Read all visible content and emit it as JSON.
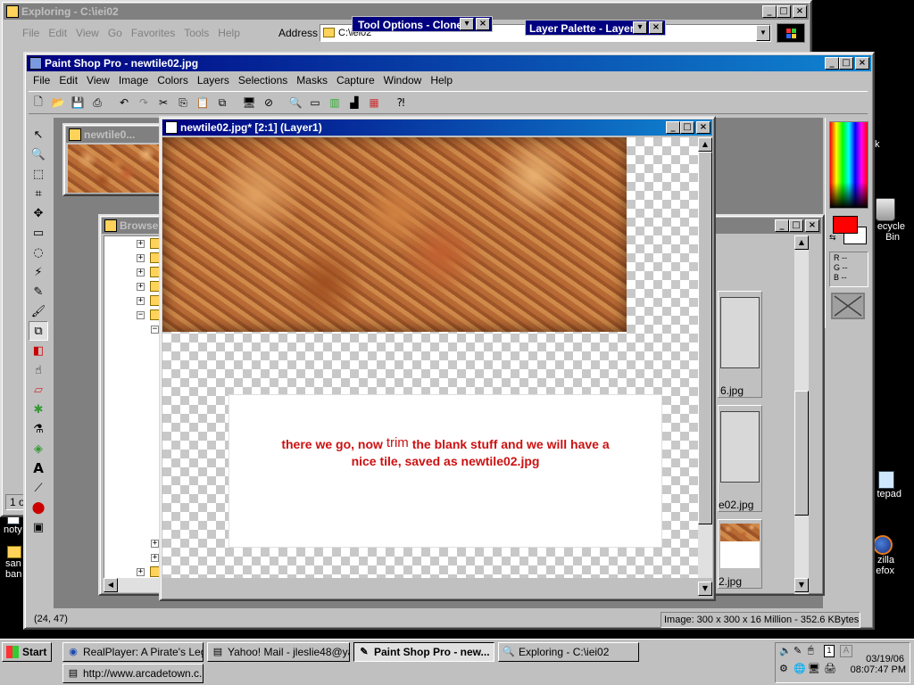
{
  "explorer": {
    "title": "Exploring - C:\\iei02",
    "menu": [
      "File",
      "Edit",
      "View",
      "Go",
      "Favorites",
      "Tools",
      "Help"
    ],
    "address_label": "Address",
    "address_value": "C:\\iei02",
    "status_left": "1 ol"
  },
  "floating": {
    "tool_options": "Tool Options - Clone",
    "layer_palette": "Layer Palette - Layer1"
  },
  "psp": {
    "title": "Paint Shop Pro - newtile02.jpg",
    "menu": [
      "File",
      "Edit",
      "View",
      "Image",
      "Colors",
      "Layers",
      "Selections",
      "Masks",
      "Capture",
      "Window",
      "Help"
    ],
    "status_coords": "(24, 47)",
    "status_image": "Image:  300 x 300 x 16 Million - 352.6 KBytes",
    "rgb": {
      "r": "R --",
      "g": "G --",
      "b": "B --"
    },
    "fg_color": "#ff0000",
    "bg_color": "#ffffff"
  },
  "thumb_window": {
    "title": "newtile0..."
  },
  "browse_window": {
    "title": "Browse",
    "thumb_labels": [
      "6.jpg",
      "e02.jpg",
      "2.jpg"
    ]
  },
  "doc_window": {
    "title": "newtile02.jpg* [2:1] (Layer1)",
    "caption_part1": "there we go, now",
    "caption_part2": "trim",
    "caption_part3": "the blank stuff and we will have a",
    "caption_line2": "nice tile, saved as newtile02.jpg"
  },
  "desktop": {
    "recycle": "Recycle Bin",
    "recycle_l1": "ecycle",
    "recycle_l2": "Bin",
    "notepad": "tepad",
    "firefox_l1": "zilla",
    "firefox_l2": "efox",
    "left_icon1": "noty",
    "left_icon2a": "san",
    "left_icon2b": "ban",
    "k_text": "k"
  },
  "taskbar": {
    "start": "Start",
    "items": [
      "RealPlayer: A Pirate's Leg...",
      "Yahoo! Mail - jleslie48@ya...",
      "Paint Shop Pro - new...",
      "Exploring - C:\\iei02",
      "http://www.arcadetown.c..."
    ],
    "date": "03/19/06",
    "time": "08:07:47 PM"
  }
}
